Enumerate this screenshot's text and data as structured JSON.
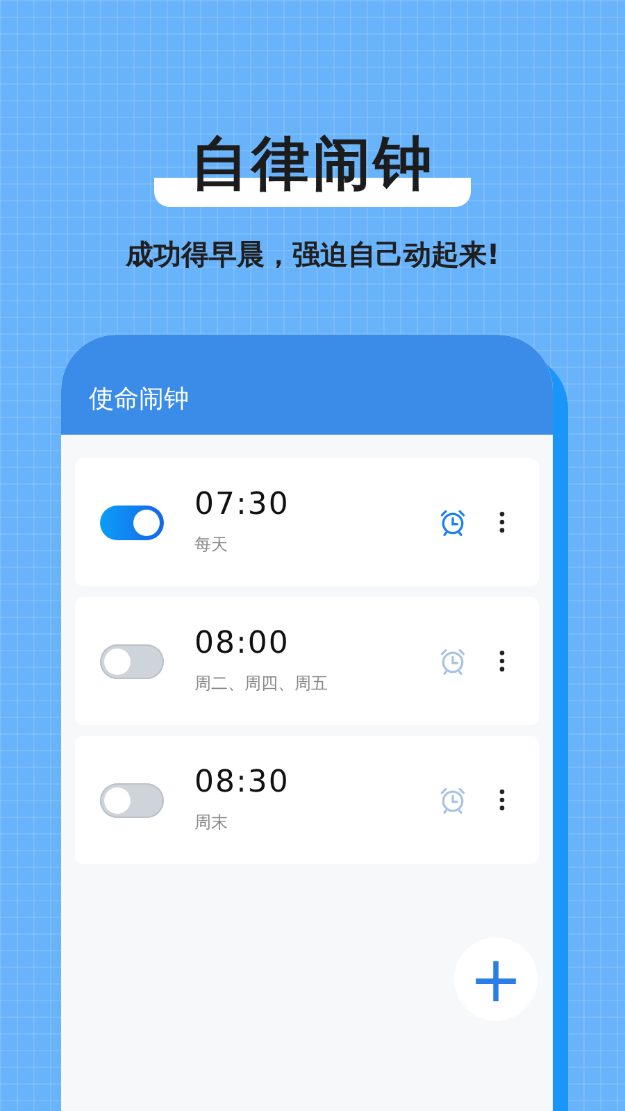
{
  "headline": "自律闹钟",
  "tagline": "成功得早晨，强迫自己动起来!",
  "app": {
    "title": "使命闹钟",
    "alarms": [
      {
        "time": "07:30",
        "repeat": "每天",
        "on": true
      },
      {
        "time": "08:00",
        "repeat": "周二、周四、周五",
        "on": false
      },
      {
        "time": "08:30",
        "repeat": "周末",
        "on": false
      }
    ],
    "add_button": "+"
  }
}
